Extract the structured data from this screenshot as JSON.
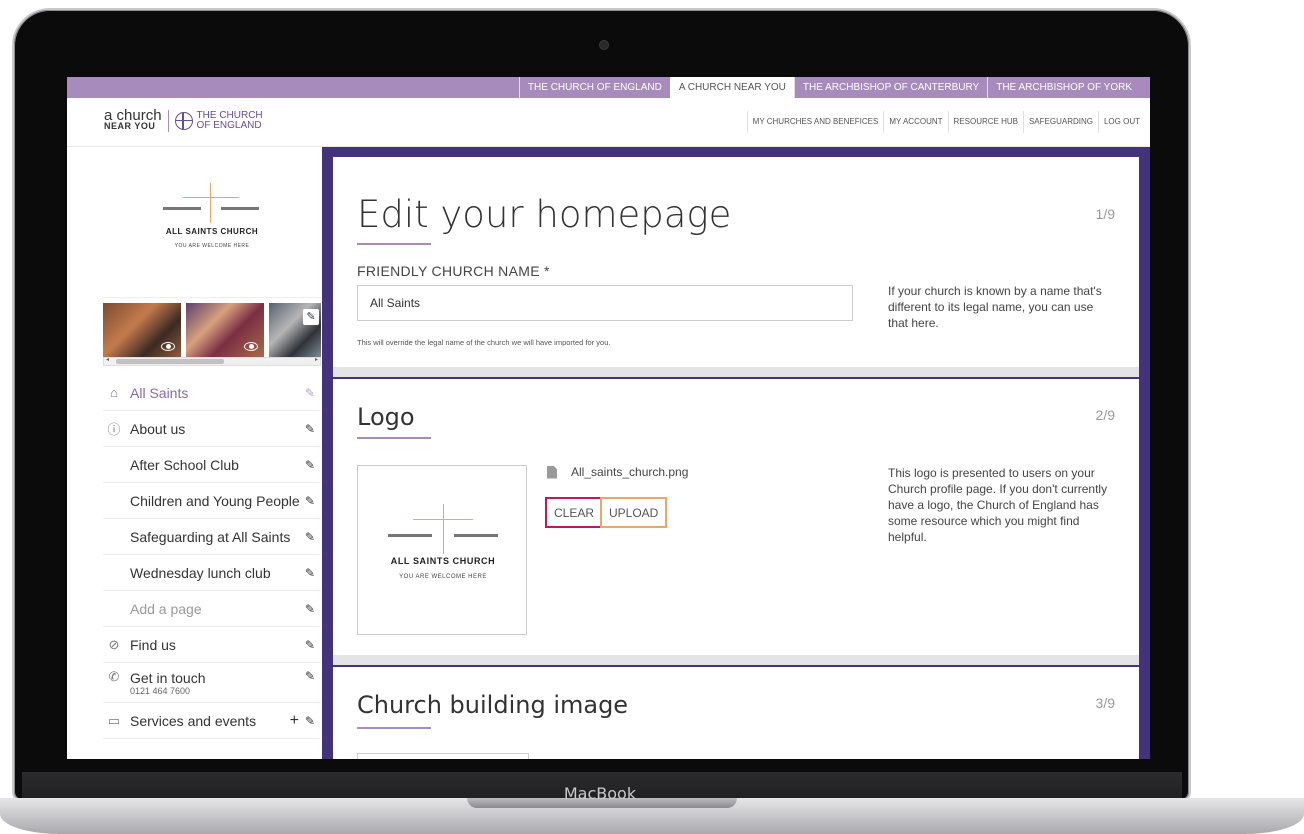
{
  "device": {
    "label": "MacBook"
  },
  "top_nav": {
    "tabs": [
      {
        "label": "THE CHURCH OF ENGLAND",
        "active": false
      },
      {
        "label": "A CHURCH NEAR YOU",
        "active": true
      },
      {
        "label": "THE ARCHBISHOP OF CANTERBURY",
        "active": false
      },
      {
        "label": "THE ARCHBISHOP OF YORK",
        "active": false
      }
    ]
  },
  "header": {
    "brand": {
      "line1": "a church",
      "line2": "NEAR YOU",
      "coe_line1": "THE CHURCH",
      "coe_line2": "OF ENGLAND"
    },
    "user_nav": [
      "MY CHURCHES AND BENEFICES",
      "MY ACCOUNT",
      "RESOURCE HUB",
      "SAFEGUARDING",
      "LOG OUT"
    ]
  },
  "sidebar": {
    "church_logo": {
      "name": "ALL SAINTS CHURCH",
      "tagline": "YOU ARE WELCOME HERE"
    },
    "menu": [
      {
        "label": "All Saints",
        "icon": "home-icon",
        "action": "edit",
        "active": true
      },
      {
        "label": "About us",
        "icon": "info-icon",
        "action": "edit"
      },
      {
        "label": "After School Club",
        "icon": "",
        "action": "edit",
        "sub": true
      },
      {
        "label": "Children and Young People",
        "icon": "",
        "action": "edit",
        "sub": true
      },
      {
        "label": "Safeguarding at All Saints",
        "icon": "",
        "action": "edit",
        "sub": true
      },
      {
        "label": "Wednesday lunch club",
        "icon": "",
        "action": "edit",
        "sub": true
      },
      {
        "label": "Add a page",
        "icon": "",
        "action": "edit",
        "sub": true,
        "muted": true
      },
      {
        "label": "Find us",
        "icon": "compass-icon",
        "action": "edit"
      },
      {
        "label": "Get in touch",
        "secondary": "0121 464 7600",
        "icon": "phone-icon",
        "action": "edit"
      },
      {
        "label": "Services and events",
        "icon": "calendar-icon",
        "action": "add-edit"
      }
    ]
  },
  "main": {
    "page_title": "Edit your homepage",
    "sections": {
      "name": {
        "step": "1/9",
        "field_label": "FRIENDLY CHURCH NAME *",
        "value": "All Saints",
        "hint": "This will override the legal name of the church we will have imported for you.",
        "help": "If your church is known by a name that's different to its legal name, you can use that here."
      },
      "logo": {
        "title": "Logo",
        "step": "2/9",
        "filename": "All_saints_church.png",
        "clear_label": "CLEAR",
        "upload_label": "UPLOAD",
        "preview_name": "ALL SAINTS CHURCH",
        "preview_tagline": "YOU ARE WELCOME HERE",
        "help": "This logo is presented to users on your Church profile page. If you don't currently have a logo, the Church of England has some resource which you might find helpful."
      },
      "building": {
        "title": "Church building image",
        "step": "3/9"
      }
    }
  },
  "colors": {
    "accent": "#a78bbd",
    "panel": "#43337a",
    "clear_border": "#c2185b",
    "upload_border": "#e8a866"
  }
}
